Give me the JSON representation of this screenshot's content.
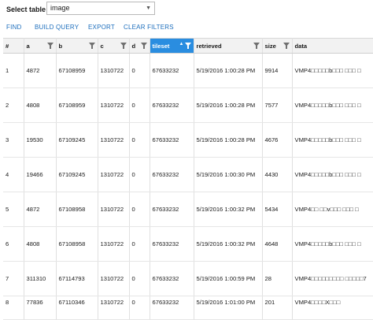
{
  "header": {
    "select_label": "Select table",
    "select_value": "image"
  },
  "toolbar": {
    "find": "FIND",
    "build_query": "BUILD QUERY",
    "export": "EXPORT",
    "clear_filters": "CLEAR FILTERS"
  },
  "accent_color": "#2a8de0",
  "link_color": "#1e6fbd",
  "table": {
    "columns": [
      "#",
      "a",
      "b",
      "c",
      "d",
      "tileset",
      "retrieved",
      "size",
      "data"
    ],
    "sorted_column": "tileset",
    "rows": [
      {
        "n": "1",
        "a": "4872",
        "b": "67108959",
        "c": "1310722",
        "d": "0",
        "tileset": "67633232",
        "retrieved": "5/19/2016 1:00:28 PM",
        "size": "9914",
        "data": "VMP4□□□□□b□□□ □□□ □"
      },
      {
        "n": "2",
        "a": "4808",
        "b": "67108959",
        "c": "1310722",
        "d": "0",
        "tileset": "67633232",
        "retrieved": "5/19/2016 1:00:28 PM",
        "size": "7577",
        "data": "VMP4□□□□□b□□□ □□□ □"
      },
      {
        "n": "3",
        "a": "19530",
        "b": "67109245",
        "c": "1310722",
        "d": "0",
        "tileset": "67633232",
        "retrieved": "5/19/2016 1:00:28 PM",
        "size": "4676",
        "data": "VMP4□□□□□b□□□ □□□ □"
      },
      {
        "n": "4",
        "a": "19466",
        "b": "67109245",
        "c": "1310722",
        "d": "0",
        "tileset": "67633232",
        "retrieved": "5/19/2016 1:00:30 PM",
        "size": "4430",
        "data": "VMP4□□□□□b□□□ □□□ □"
      },
      {
        "n": "5",
        "a": "4872",
        "b": "67108958",
        "c": "1310722",
        "d": "0",
        "tileset": "67633232",
        "retrieved": "5/19/2016 1:00:32 PM",
        "size": "5434",
        "data": "VMP4□□ □□v□□□ □□□ □"
      },
      {
        "n": "6",
        "a": "4808",
        "b": "67108958",
        "c": "1310722",
        "d": "0",
        "tileset": "67633232",
        "retrieved": "5/19/2016 1:00:32 PM",
        "size": "4648",
        "data": "VMP4□□□□□b□□□ □□□ □"
      },
      {
        "n": "7",
        "a": "311310",
        "b": "67114793",
        "c": "1310722",
        "d": "0",
        "tileset": "67633232",
        "retrieved": "5/19/2016 1:00:59 PM",
        "size": "28",
        "data": "VMP4□□□□□□□□□ □□□□□7"
      },
      {
        "n": "8",
        "a": "77836",
        "b": "67110346",
        "c": "1310722",
        "d": "0",
        "tileset": "67633232",
        "retrieved": "5/19/2016 1:01:00 PM",
        "size": "201",
        "data": "VMP4□□□□X□□□"
      }
    ]
  }
}
